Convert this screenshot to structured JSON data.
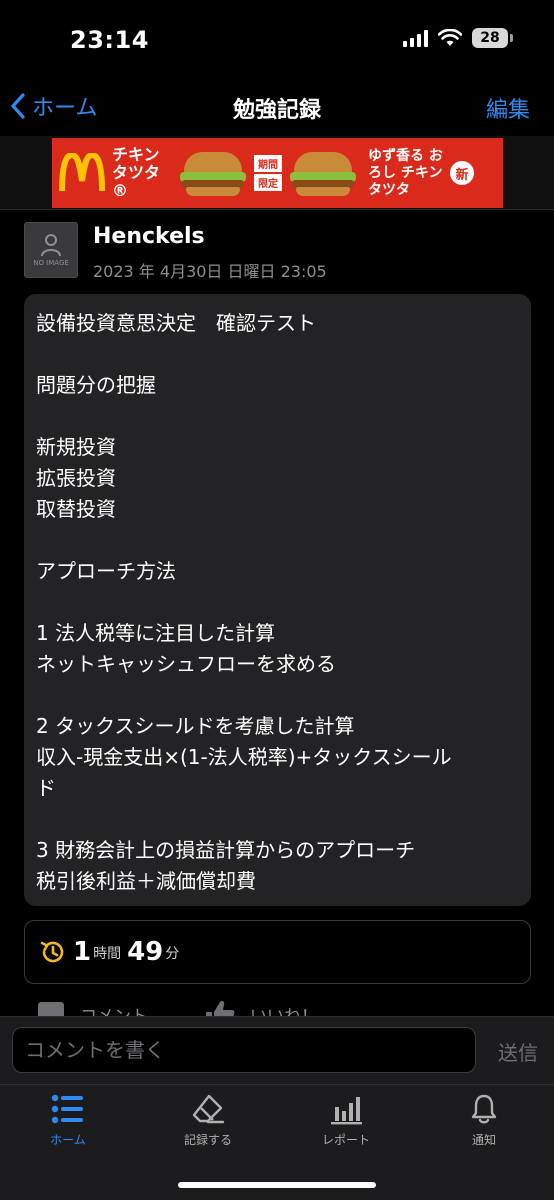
{
  "status_bar": {
    "time": "23:14",
    "battery": "28"
  },
  "nav": {
    "back_label": "ホーム",
    "title": "勉強記録",
    "edit_label": "編集"
  },
  "ad": {
    "text_left": "チキンタツタ®",
    "badge1": "期間",
    "badge2": "限定",
    "text_right": "ゆず香る おろし チキンタツタ",
    "new_label": "新"
  },
  "post": {
    "avatar_caption": "NO IMAGE",
    "author": "Henckels",
    "date": "2023 年 4月30日 日曜日 23:05",
    "lines": [
      "設備投資意思決定　確認テスト",
      "",
      "問題分の把握",
      "",
      "新規投資",
      "拡張投資",
      "取替投資",
      "",
      "アプローチ方法",
      "",
      "1 法人税等に注目した計算",
      "ネットキャッシュフローを求める",
      "",
      "2 タックスシールドを考慮した計算",
      "収入-現金支出×(1-法人税率)+タックスシール",
      "ド",
      "",
      "3 財務会計上の損益計算からのアプローチ",
      "税引後利益＋減価償却費"
    ],
    "study_time": {
      "hours": "1",
      "hours_unit": "時間",
      "minutes": "49",
      "minutes_unit": "分"
    }
  },
  "actions": {
    "comment_label": "コメント",
    "like_label": "いいね！"
  },
  "comment_bar": {
    "placeholder": "コメントを書く",
    "send_label": "送信"
  },
  "tab_bar": {
    "items": [
      {
        "label": "ホーム",
        "icon": "list-icon"
      },
      {
        "label": "記録する",
        "icon": "eraser-icon"
      },
      {
        "label": "レポート",
        "icon": "bar-chart-icon"
      },
      {
        "label": "通知",
        "icon": "bell-icon"
      }
    ]
  },
  "colors": {
    "accent": "#2f8bf0",
    "background": "#000000",
    "card": "#232325",
    "clock": "#f5b72b",
    "ad_red": "#d92a1c"
  }
}
